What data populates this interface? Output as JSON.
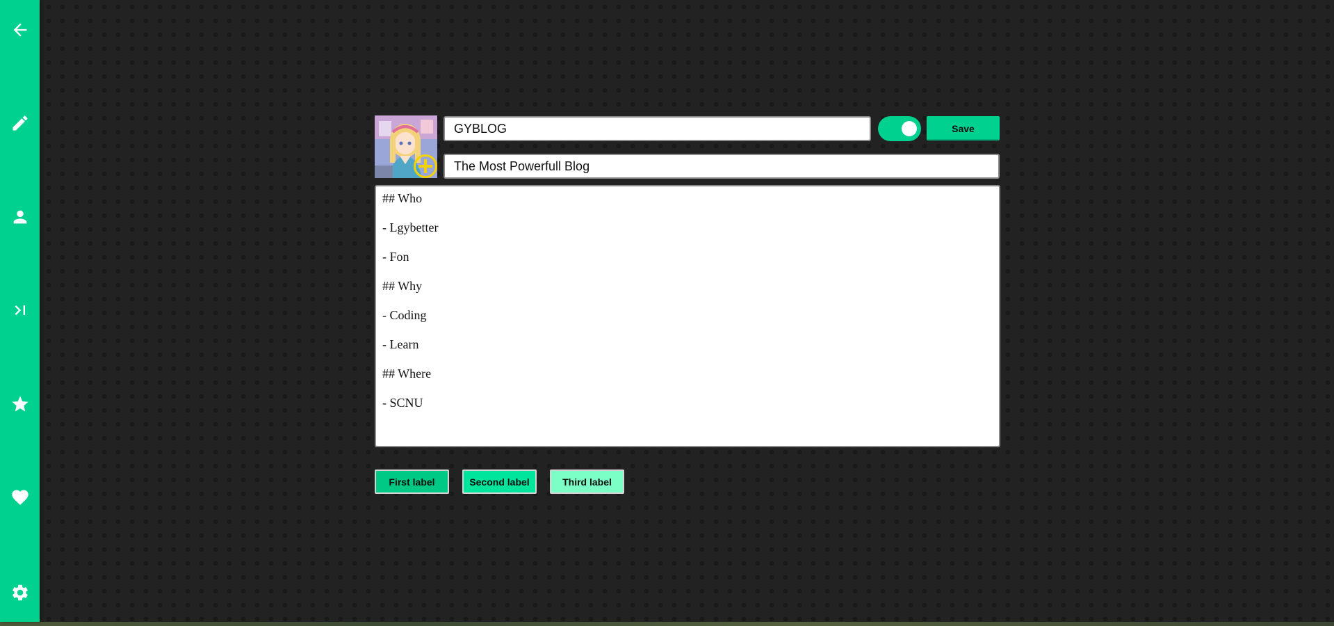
{
  "sidebar": {
    "items": [
      {
        "icon": "back-arrow-icon"
      },
      {
        "icon": "pencil-icon"
      },
      {
        "icon": "person-icon"
      },
      {
        "icon": "terminal-icon"
      },
      {
        "icon": "star-icon"
      },
      {
        "icon": "heart-icon"
      },
      {
        "icon": "gear-icon"
      }
    ],
    "color": "#00d18f"
  },
  "editor": {
    "avatar": {
      "icon": "add-image-icon"
    },
    "title_value": "GYBLOG",
    "subtitle_value": "The Most Powerfull Blog",
    "publish_toggle_on": true,
    "save_label": "Save",
    "content_lines": [
      "## Who",
      "- Lgybetter",
      "- Fon",
      "## Why",
      "- Coding",
      "- Learn",
      "## Where",
      "- SCNU"
    ]
  },
  "labels": [
    {
      "text": "First label",
      "color": "#00c985"
    },
    {
      "text": "Second label",
      "color": "#00e59c"
    },
    {
      "text": "Third label",
      "color": "#7cffc6"
    }
  ],
  "colors": {
    "accent": "#00d18f",
    "background": "#222222"
  }
}
